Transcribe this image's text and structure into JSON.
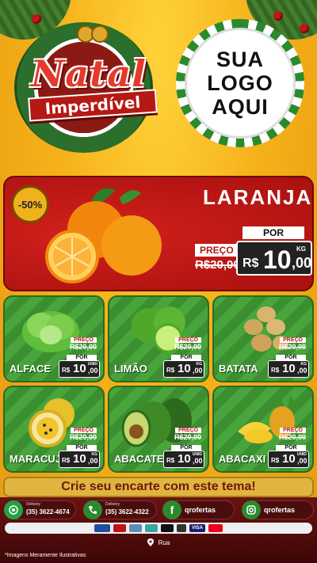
{
  "header": {
    "title_main": "Natal",
    "title_ribbon": "Imperdível",
    "logo_lines": [
      "SUA",
      "LOGO",
      "AQUI"
    ]
  },
  "featured": {
    "badge": "-50%",
    "name": "LARANJA",
    "preco_label": "PREÇO",
    "old_price": "R$20,00",
    "por_label": "POR",
    "currency": "R$",
    "price_int": "10",
    "price_cents": ",00",
    "unit": "KG"
  },
  "products": [
    {
      "name": "ALFACE",
      "preco_label": "PREÇO",
      "old_price": "R$20,00",
      "por_label": "POR",
      "currency": "R$",
      "price_int": "10",
      "price_cents": ",00",
      "unit": "UNID"
    },
    {
      "name": "LIMÃO",
      "preco_label": "PREÇO",
      "old_price": "R$20,00",
      "por_label": "POR",
      "currency": "R$",
      "price_int": "10",
      "price_cents": ",00",
      "unit": "KG"
    },
    {
      "name": "BATATA",
      "preco_label": "PREÇO",
      "old_price": "R$20,00",
      "por_label": "POR",
      "currency": "R$",
      "price_int": "10",
      "price_cents": ",00",
      "unit": "KG"
    },
    {
      "name": "MARACUJÁ",
      "preco_label": "PREÇO",
      "old_price": "R$20,00",
      "por_label": "POR",
      "currency": "R$",
      "price_int": "10",
      "price_cents": ",00",
      "unit": "KG"
    },
    {
      "name": "ABACATE",
      "preco_label": "PREÇO",
      "old_price": "R$20,00",
      "por_label": "POR",
      "currency": "R$",
      "price_int": "10",
      "price_cents": ",00",
      "unit": "UNID"
    },
    {
      "name": "ABACAXI",
      "preco_label": "PREÇO",
      "old_price": "R$20,00",
      "por_label": "POR",
      "currency": "R$",
      "price_int": "10",
      "price_cents": ",00",
      "unit": "UNID"
    }
  ],
  "cta": {
    "text": "Crie seu encarte com este tema!"
  },
  "contacts": {
    "delivery1_label": "Delivery",
    "delivery1_phone": "(35) 3622-4674",
    "delivery2_label": "Delivery",
    "delivery2_phone": "(35) 3622-4322",
    "facebook_handle": "qrofertas",
    "instagram_handle": "qrofertas"
  },
  "payments": [
    "",
    "",
    "",
    "",
    "",
    "",
    "VISA",
    ""
  ],
  "address": {
    "text": "Rua"
  },
  "footnote": "*Imagens Meramente Ilustrativas",
  "colors": {
    "brand_red": "#b61915",
    "green": "#3c8f31",
    "gold": "#f6b21a"
  }
}
